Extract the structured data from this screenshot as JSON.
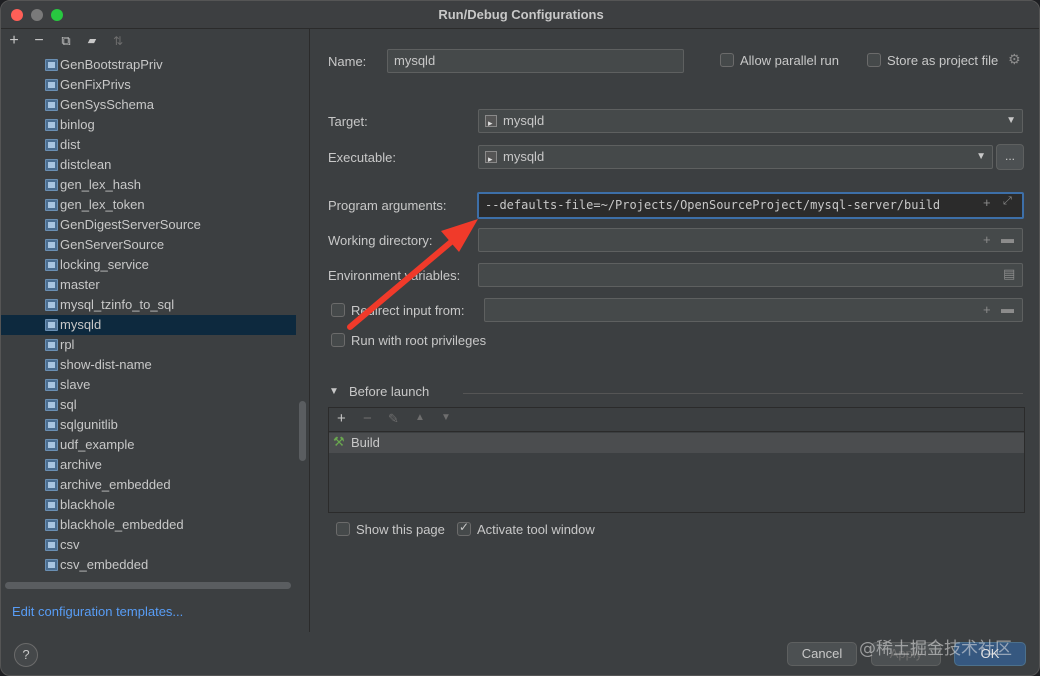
{
  "window": {
    "title": "Run/Debug Configurations"
  },
  "toolbar": {
    "add": "+",
    "remove": "−",
    "copy": "⧉",
    "folder": "▰",
    "sort": "⇅"
  },
  "tree": {
    "items": [
      {
        "label": "GenBootstrapPriv"
      },
      {
        "label": "GenFixPrivs"
      },
      {
        "label": "GenSysSchema"
      },
      {
        "label": "binlog"
      },
      {
        "label": "dist"
      },
      {
        "label": "distclean"
      },
      {
        "label": "gen_lex_hash"
      },
      {
        "label": "gen_lex_token"
      },
      {
        "label": "GenDigestServerSource"
      },
      {
        "label": "GenServerSource"
      },
      {
        "label": "locking_service"
      },
      {
        "label": "master"
      },
      {
        "label": "mysql_tzinfo_to_sql"
      },
      {
        "label": "mysqld",
        "selected": true
      },
      {
        "label": "rpl"
      },
      {
        "label": "show-dist-name"
      },
      {
        "label": "slave"
      },
      {
        "label": "sql"
      },
      {
        "label": "sqlgunitlib"
      },
      {
        "label": "udf_example"
      },
      {
        "label": "archive"
      },
      {
        "label": "archive_embedded"
      },
      {
        "label": "blackhole"
      },
      {
        "label": "blackhole_embedded"
      },
      {
        "label": "csv"
      },
      {
        "label": "csv_embedded"
      }
    ]
  },
  "left_footer": {
    "edit_templates": "Edit configuration templates...",
    "help": "?"
  },
  "form": {
    "name_label": "Name:",
    "name_value": "mysqld",
    "allow_parallel": "Allow parallel run",
    "store_project": "Store as project file",
    "target_label": "Target:",
    "target_value": "mysqld",
    "executable_label": "Executable:",
    "executable_value": "mysqld",
    "dots": "...",
    "args_label": "Program arguments:",
    "args_value": "--defaults-file=~/Projects/OpenSourceProject/mysql-server/build",
    "workdir_label": "Working directory:",
    "env_label": "Environment variables:",
    "redirect_label": "Redirect input from:",
    "root_label": "Run with root privileges"
  },
  "before_launch": {
    "title": "Before launch",
    "tools": [
      "+",
      "−",
      "✎",
      "▲",
      "▼"
    ],
    "tasks": [
      {
        "label": "Build"
      }
    ],
    "show_page": "Show this page",
    "activate_tool": "Activate tool window"
  },
  "buttons": {
    "cancel": "Cancel",
    "apply": "Apply",
    "ok": "OK"
  },
  "watermark": "@稀土掘金技术社区",
  "colors": {
    "accent": "#3d6fa8",
    "selection": "#0d293e",
    "arrow": "#f03a2a"
  }
}
